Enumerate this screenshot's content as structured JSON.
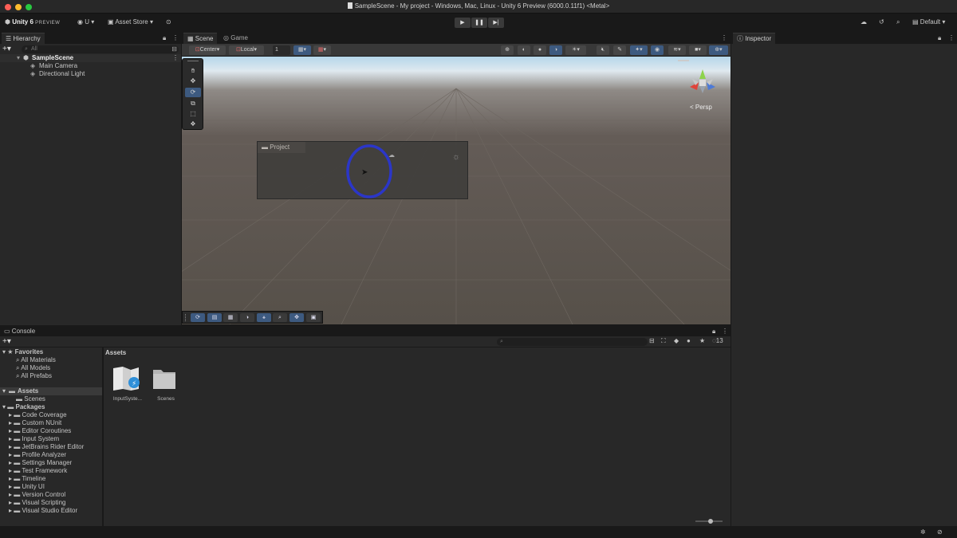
{
  "window": {
    "title": "SampleScene - My project - Windows, Mac, Linux - Unity 6 Preview (6000.0.11f1) <Metal>"
  },
  "toolbar": {
    "app_name": "Unity 6",
    "app_badge": "PREVIEW",
    "account_label": "U",
    "asset_store_label": "Asset Store",
    "layout_label": "Default"
  },
  "hierarchy": {
    "tab_label": "Hierarchy",
    "search_placeholder": "All",
    "scene_name": "SampleScene",
    "items": [
      {
        "label": "Main Camera"
      },
      {
        "label": "Directional Light"
      }
    ]
  },
  "scene_view": {
    "tabs": [
      {
        "label": "Scene"
      },
      {
        "label": "Game"
      }
    ],
    "pivot_mode": "Center",
    "pivot_rotation": "Local",
    "grid_value": "1",
    "camera_mode": "< Persp",
    "floating_panel_title": "Project"
  },
  "inspector": {
    "tab_label": "Inspector"
  },
  "console": {
    "tab_label": "Console",
    "hidden_count": "13"
  },
  "project": {
    "favorites_label": "Favorites",
    "favorites": [
      {
        "label": "All Materials"
      },
      {
        "label": "All Models"
      },
      {
        "label": "All Prefabs"
      }
    ],
    "assets_label": "Assets",
    "assets_children": [
      {
        "label": "Scenes"
      }
    ],
    "packages_label": "Packages",
    "packages": [
      {
        "label": "Code Coverage"
      },
      {
        "label": "Custom NUnit"
      },
      {
        "label": "Editor Coroutines"
      },
      {
        "label": "Input System"
      },
      {
        "label": "JetBrains Rider Editor"
      },
      {
        "label": "Profile Analyzer"
      },
      {
        "label": "Settings Manager"
      },
      {
        "label": "Test Framework"
      },
      {
        "label": "Timeline"
      },
      {
        "label": "Unity UI"
      },
      {
        "label": "Version Control"
      },
      {
        "label": "Visual Scripting"
      },
      {
        "label": "Visual Studio Editor"
      }
    ],
    "breadcrumb": "Assets",
    "asset_items": [
      {
        "label": "InputSyste..."
      },
      {
        "label": "Scenes"
      }
    ]
  },
  "colors": {
    "accent_blue": "#3d5a80",
    "highlight_circle": "#2b36c8",
    "panel_bg": "#282828",
    "dark_bg": "#191919"
  }
}
